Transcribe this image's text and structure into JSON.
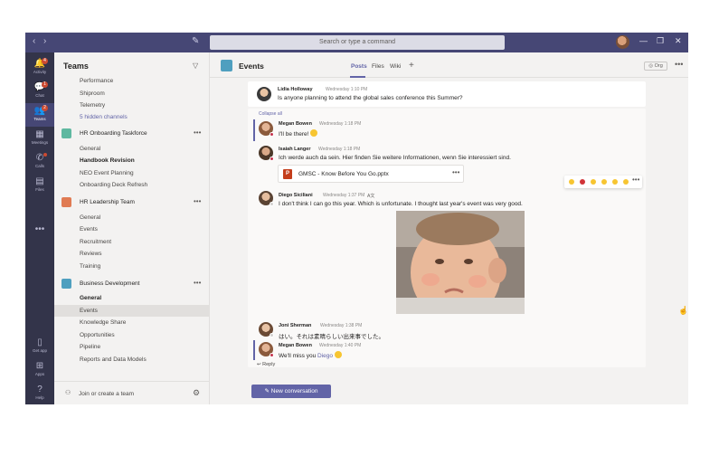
{
  "titlebar": {
    "search_placeholder": "Search or type a command",
    "back_glyph": "‹",
    "forward_glyph": "›",
    "compose_glyph": "✎",
    "minimize_glyph": "—",
    "restore_glyph": "❐",
    "close_glyph": "✕"
  },
  "rail": {
    "items": [
      {
        "label": "Activity",
        "icon": "bell-icon",
        "glyph": "🔔",
        "badge": "4"
      },
      {
        "label": "Chat",
        "icon": "chat-icon",
        "glyph": "💬",
        "badge": "1"
      },
      {
        "label": "Teams",
        "icon": "teams-icon",
        "glyph": "👥",
        "badge": "2"
      },
      {
        "label": "Meetings",
        "icon": "calendar-icon",
        "glyph": "▦"
      },
      {
        "label": "Calls",
        "icon": "phone-icon",
        "glyph": "✆"
      },
      {
        "label": "Files",
        "icon": "file-icon",
        "glyph": "▤"
      },
      {
        "label": "Get app",
        "icon": "phone-device-icon",
        "glyph": "▯"
      },
      {
        "label": "Apps",
        "icon": "apps-icon",
        "glyph": "⊞"
      },
      {
        "label": "Help",
        "icon": "help-icon",
        "glyph": "?"
      }
    ],
    "more_glyph": "•••"
  },
  "panel": {
    "title": "Teams",
    "top_channels": [
      "Performance",
      "Shiproom",
      "Telemetry"
    ],
    "hidden_channels": "5 hidden channels",
    "teams": [
      {
        "name": "HR Onboarding Taskforce",
        "color": "#5fb8a0",
        "channels": [
          "General",
          "Handbook Revision",
          "NEO Event Planning",
          "Onboarding Deck Refresh"
        ]
      },
      {
        "name": "HR Leadership Team",
        "color": "#e07b53",
        "channels": [
          "General",
          "Events",
          "Recruitment",
          "Reviews",
          "Training"
        ]
      },
      {
        "name": "Business Development",
        "color": "#4f9fbf",
        "channels": [
          "General",
          "Events",
          "Knowledge Share",
          "Opportunities",
          "Pipeline",
          "Reports and Data Models"
        ]
      }
    ],
    "join_label": "Join or create a team"
  },
  "channel": {
    "title": "Events",
    "tabs": [
      "Posts",
      "Files",
      "Wiki"
    ],
    "org_label": "Org"
  },
  "messages": {
    "top": {
      "author": "Lidia Holloway",
      "time": "Wednesday 1:10 PM",
      "text": "Is anyone planning to attend the global sales conference this Summer?"
    },
    "collapse_label": "Collapse all",
    "replies": [
      {
        "author": "Megan Bowen",
        "time": "Wednesday 1:18 PM",
        "text": "I'll be there!"
      },
      {
        "author": "Isaiah Langer",
        "time": "Wednesday 1:18 PM",
        "text": "Ich werde auch da sein.  Hier finden Sie weitere Informationen, wenn Sie interessiert sind."
      },
      {
        "author": "Diego Siciliani",
        "time": "Wednesday 1:37 PM",
        "text": "I don't think I can go this year. Which is unfortunate. I thought last year's event was very good."
      },
      {
        "author": "Joni Sherman",
        "time": "Wednesday 1:38 PM",
        "text": "はい。それは素晴らしい出来事でした。"
      },
      {
        "author": "Megan Bowen",
        "time": "Wednesday 1:40 PM",
        "text_before": "We'll miss you ",
        "mention": "Diego"
      }
    ],
    "attachment": {
      "name": "GMSC - Know Before You Go.pptx",
      "type_letter": "P"
    },
    "translate_glyph": "A文",
    "reply_label": "Reply"
  },
  "new_conversation_label": "New conversation",
  "colors": {
    "accent": "#6264a7",
    "titlebar": "#464775",
    "rail": "#33344a"
  }
}
